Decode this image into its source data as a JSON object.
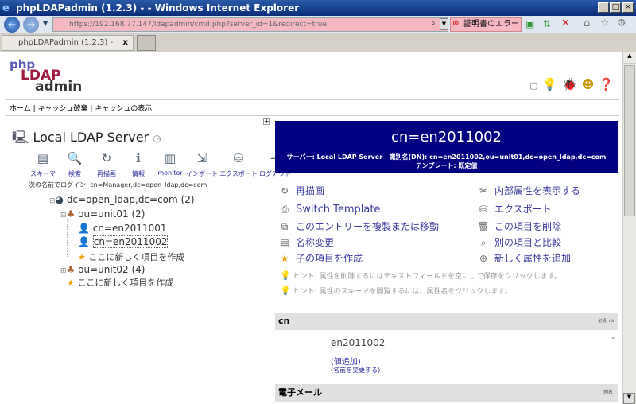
{
  "browser": {
    "title": "phpLDAPadmin (1.2.3) - - Windows Internet Explorer",
    "url": "https://192.168.77.147/ldapadmin/cmd.php?server_id=1&redirect=true",
    "cert_error": "証明書のエラー",
    "tab_label": "phpLDAPadmin (1.2.3) -"
  },
  "logo": {
    "line1": "php",
    "line2": "LDAP",
    "line3": "admin"
  },
  "topnav": {
    "items": [
      "ホーム",
      "キャッシュ破棄",
      "キャッシュの表示"
    ],
    "separator": "|"
  },
  "server": {
    "name": "Local LDAP Server",
    "login_label": "次の名前でログイン:",
    "login_dn": "cn=Manager,dc=open_ldap,dc=com",
    "tools": [
      {
        "label": "スキーマ",
        "icon": "schema-icon"
      },
      {
        "label": "検索",
        "icon": "search-icon"
      },
      {
        "label": "再描画",
        "icon": "refresh-icon"
      },
      {
        "label": "情報",
        "icon": "info-icon"
      },
      {
        "label": "monitor",
        "icon": "monitor-icon"
      },
      {
        "label": "インポート",
        "icon": "import-icon"
      },
      {
        "label": "エクスポート",
        "icon": "export-icon"
      },
      {
        "label": "ログアウト",
        "icon": "logout-icon"
      }
    ]
  },
  "tree": {
    "root": "dc=open_ldap,dc=com (2)",
    "unit01": "ou=unit01 (2)",
    "entries": [
      "cn=en2011001",
      "cn=en2011002"
    ],
    "create1": "ここに新しく項目を作成",
    "unit02": "ou=unit02 (4)",
    "create2": "ここに新しく項目を作成"
  },
  "entry": {
    "title": "cn=en2011002",
    "server_label": "サーバー:",
    "server": "Local LDAP Server",
    "dn_label": "識別名(DN):",
    "dn": "cn=en2011002,ou=unit01,dc=open_ldap,dc=com",
    "template_label": "テンプレート:",
    "template": "既定値"
  },
  "actions_left": [
    "再描画",
    "Switch Template",
    "このエントリーを複製または移動",
    "名称変更",
    "子の項目を作成"
  ],
  "actions_right": [
    "内部属性を表示する",
    "エクスポート",
    "この項目を削除",
    "別の項目と比較",
    "新しく属性を追加"
  ],
  "hints": [
    "ヒント: 属性を削除するにはテキストフィールドを空にして保存をクリックします。",
    "ヒント: 属性のスキーマを閲覧するには、属性名をクリックします。"
  ],
  "attributes": [
    {
      "name": "cn",
      "note": "必須, rdn",
      "value": "en2011002",
      "add_value": "(値追加)",
      "rename": "(名前を変更する)"
    },
    {
      "name": "電子メール",
      "note": "別名"
    }
  ]
}
